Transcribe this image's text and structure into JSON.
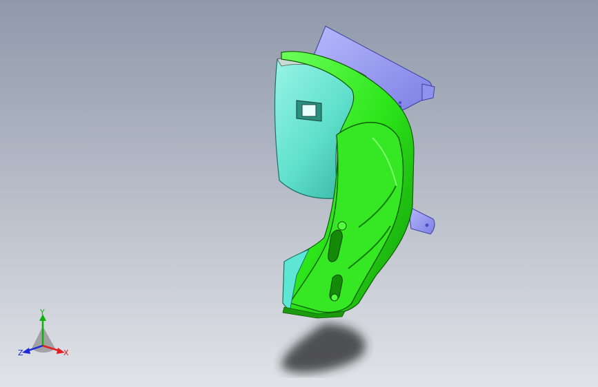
{
  "viewport": {
    "background_top": "#8f99aa",
    "background_bottom": "#e1e3e8"
  },
  "model": {
    "icon": "3d-part-model",
    "colors": {
      "main_part": "#2ce61a",
      "main_part_shade": "#18a80c",
      "inner_surface": "#5fe0cc",
      "inner_surface_dark": "#2aa896",
      "bracket": "#9a9cf0",
      "bracket_holes": "#4a4cc8",
      "shadow": "#2a2a2a"
    }
  },
  "triad": {
    "icon": "coordinate-triad",
    "y_label": "Y",
    "x_label": "X",
    "z_label": "Z",
    "colors": {
      "x": "#e02020",
      "y": "#10b010",
      "z": "#1a2ad8"
    }
  }
}
